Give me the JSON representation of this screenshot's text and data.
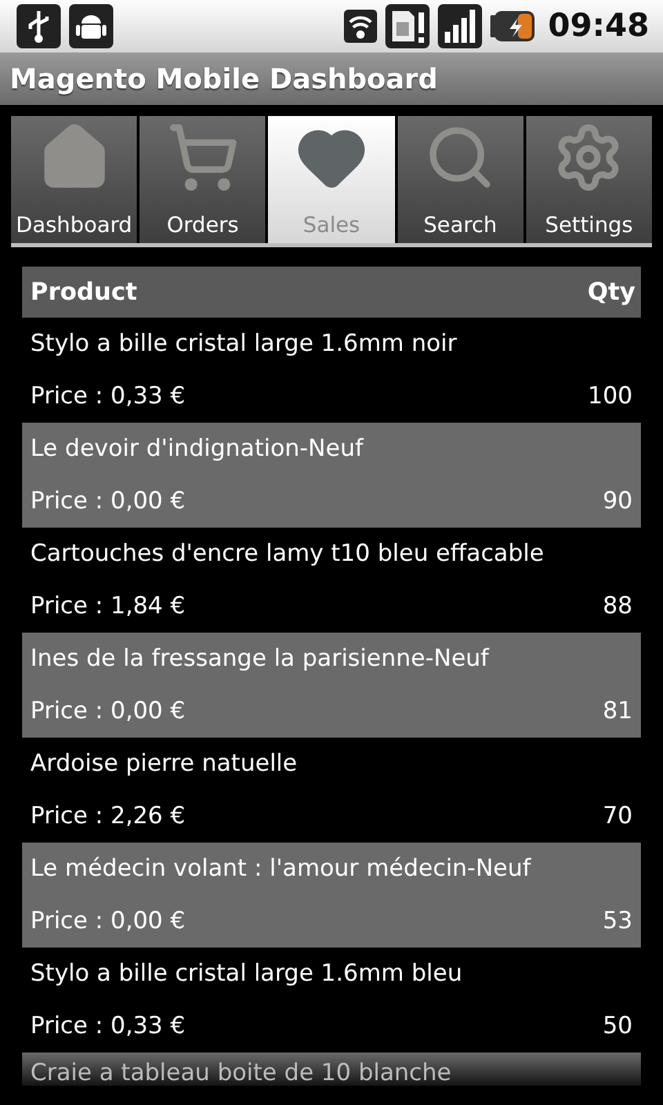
{
  "status_bar": {
    "time": "09:48"
  },
  "title": "Magento Mobile Dashboard",
  "tabs": [
    {
      "label": "Dashboard",
      "kind": "home",
      "selected": false
    },
    {
      "label": "Orders",
      "kind": "cart",
      "selected": false
    },
    {
      "label": "Sales",
      "kind": "heart",
      "selected": true
    },
    {
      "label": "Search",
      "kind": "search",
      "selected": false
    },
    {
      "label": "Settings",
      "kind": "gear",
      "selected": false
    }
  ],
  "table": {
    "columns": [
      "Product",
      "Qty"
    ],
    "rows": [
      {
        "product": "Stylo a bille cristal large 1.6mm noir",
        "price": "Price : 0,33 €",
        "qty": "100"
      },
      {
        "product": "Le devoir d'indignation-Neuf",
        "price": "Price : 0,00 €",
        "qty": "90"
      },
      {
        "product": "Cartouches d'encre lamy t10 bleu effacable",
        "price": "Price : 1,84 €",
        "qty": "88"
      },
      {
        "product": "Ines de la fressange la parisienne-Neuf",
        "price": "Price : 0,00 €",
        "qty": "81"
      },
      {
        "product": "Ardoise pierre natuelle",
        "price": "Price : 2,26 €",
        "qty": "70"
      },
      {
        "product": "Le médecin volant : l'amour médecin-Neuf",
        "price": "Price : 0,00 €",
        "qty": "53"
      },
      {
        "product": "Stylo a bille cristal large 1.6mm bleu",
        "price": "Price : 0,33 €",
        "qty": "50"
      },
      {
        "product": "Craie a tableau boite de 10 blanche"
      }
    ]
  }
}
